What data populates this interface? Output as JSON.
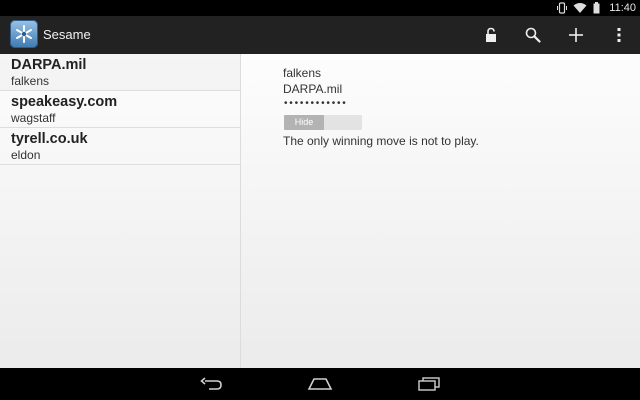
{
  "status_bar": {
    "time": "11:40",
    "icons": [
      "vibrate-icon",
      "wifi-icon",
      "battery-icon"
    ]
  },
  "action_bar": {
    "title": "Sesame",
    "actions": [
      "lock-icon",
      "search-icon",
      "add-icon",
      "overflow-menu-icon"
    ]
  },
  "entries": [
    {
      "title": "DARPA.mil",
      "username": "falkens"
    },
    {
      "title": "speakeasy.com",
      "username": "wagstaff"
    },
    {
      "title": "tyrell.co.uk",
      "username": "eldon"
    }
  ],
  "detail": {
    "username": "falkens",
    "domain": "DARPA.mil",
    "password_mask": "••••••••••••",
    "hide_label": "Hide",
    "notes": "The only winning move is not to play."
  },
  "nav_bar": {
    "buttons": [
      "back-icon",
      "home-icon",
      "recent-apps-icon"
    ]
  },
  "colors": {
    "action_bar": "#222222",
    "content_bg": "#f5f5f5",
    "toggle_thumb": "#b3b3b3"
  }
}
